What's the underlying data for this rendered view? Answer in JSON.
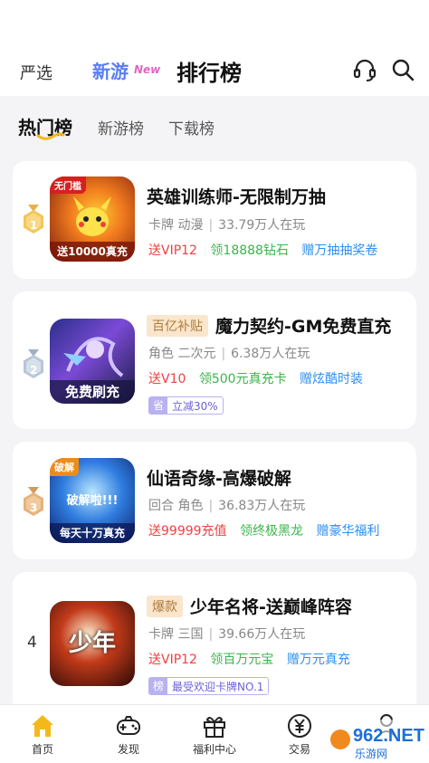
{
  "header": {
    "nav_select": "严选",
    "nav_new": "新游",
    "nav_new_tag": "New",
    "nav_rank": "排行榜"
  },
  "subtabs": [
    "热门榜",
    "新游榜",
    "下载榜"
  ],
  "games": [
    {
      "rank": "1",
      "tag": "",
      "title": "英雄训练师-无限制万抽",
      "genre1": "卡牌",
      "genre2": "动漫",
      "players": "33.79万人在玩",
      "perks": [
        "送VIP12",
        "领18888钻石",
        "赠万抽抽奖卷"
      ],
      "coupon_tag": "",
      "coupon_text": "",
      "icon_top_text": "无门槛",
      "icon_caption": "送10000真充"
    },
    {
      "rank": "2",
      "tag": "百亿补贴",
      "title": "魔力契约-GM免费直充",
      "genre1": "角色",
      "genre2": "二次元",
      "players": "6.38万人在玩",
      "perks": [
        "送V10",
        "领500元真充卡",
        "赠炫酷时装"
      ],
      "coupon_tag": "省",
      "coupon_text": "立减30%",
      "icon_top_text": "",
      "icon_caption": "免费刷充"
    },
    {
      "rank": "3",
      "tag": "",
      "title": "仙语奇缘-高爆破解",
      "genre1": "回合",
      "genre2": "角色",
      "players": "36.83万人在玩",
      "perks": [
        "送99999充值",
        "领终极黑龙",
        "赠豪华福利"
      ],
      "coupon_tag": "",
      "coupon_text": "",
      "icon_top_text": "破解",
      "icon_caption": "每天十万真充",
      "icon_mid_text": "破解啦!!!"
    },
    {
      "rank": "4",
      "tag": "爆款",
      "title": "少年名将-送巅峰阵容",
      "genre1": "卡牌",
      "genre2": "三国",
      "players": "39.66万人在玩",
      "perks": [
        "送VIP12",
        "领百万元宝",
        "赠万元真充"
      ],
      "coupon_tag": "榜",
      "coupon_text": "最受欢迎卡牌NO.1",
      "icon_top_text": "",
      "icon_caption": "",
      "icon_mid_text": "少年"
    }
  ],
  "bottom_nav": [
    {
      "label": "首页",
      "icon": "home-icon"
    },
    {
      "label": "发现",
      "icon": "gamepad-icon"
    },
    {
      "label": "福利中心",
      "icon": "gift-icon"
    },
    {
      "label": "交易",
      "icon": "yuan-icon"
    },
    {
      "label": "",
      "icon": "profile-icon"
    }
  ],
  "watermark": "962.NET 乐游网",
  "colors": {
    "accent_blue": "#5b7cf5",
    "red": "#f04040",
    "green": "#3cb54a",
    "blue": "#2f8ff0",
    "gold": "#e6b24a",
    "home_active": "#f5b81c"
  }
}
